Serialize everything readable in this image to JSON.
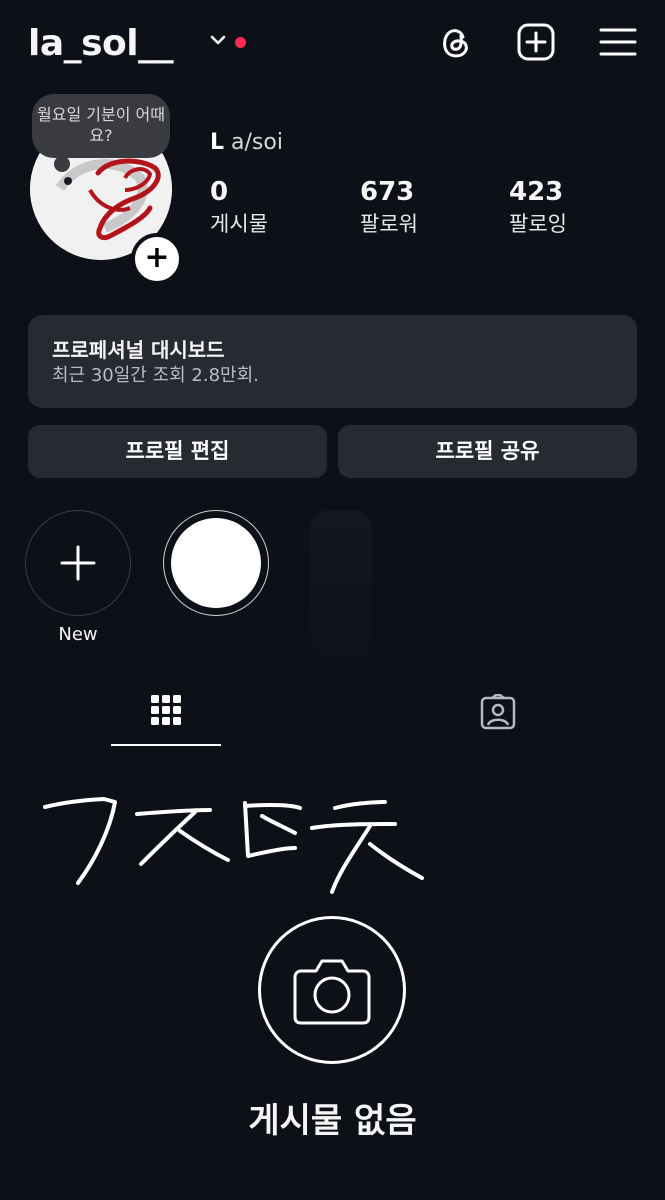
{
  "header": {
    "username": "la_sol__",
    "icons": [
      "chevron-down-icon",
      "threads-icon",
      "add-post-icon",
      "menu-icon"
    ],
    "notification_dot_color": "#ff2d55"
  },
  "profile": {
    "note_text": "월요일 기분이 어때요?",
    "name_initial": "L",
    "name_rest": "a/soi",
    "stats": [
      {
        "value": "0",
        "label": "게시물"
      },
      {
        "value": "673",
        "label": "팔로워"
      },
      {
        "value": "423",
        "label": "팔로잉"
      }
    ]
  },
  "dashboard": {
    "title": "프로페셔널 대시보드",
    "subtitle": "최근 30일간 조회 2.8만회."
  },
  "actions": {
    "edit_profile": "프로필 편집",
    "share_profile": "프로필 공유"
  },
  "highlights": {
    "new_label": "New"
  },
  "tabs": [
    "grid-icon",
    "tagged-icon"
  ],
  "empty_state": {
    "title": "게시물 없음"
  }
}
